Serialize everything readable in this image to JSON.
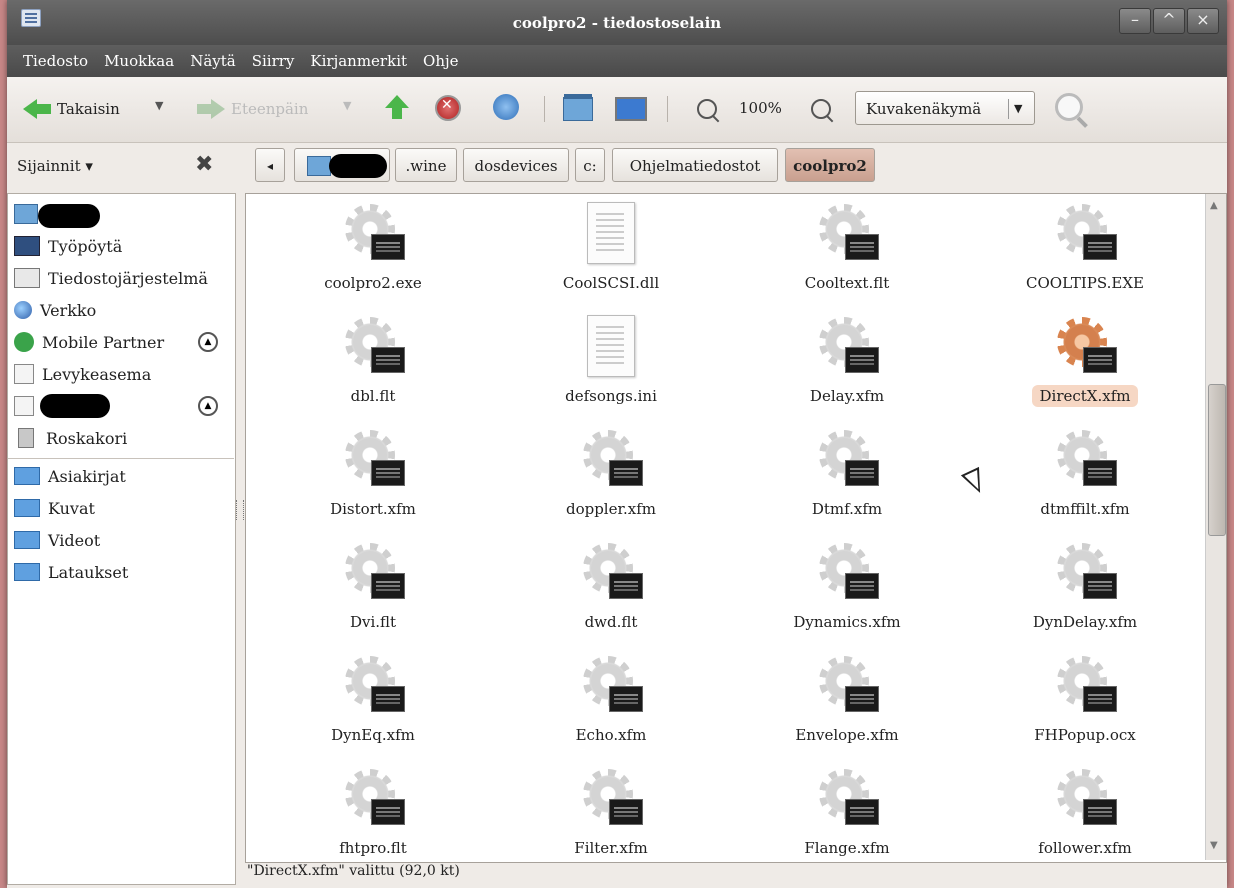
{
  "window": {
    "title": "coolpro2 - tiedostoselain"
  },
  "window_buttons": [
    "–",
    "^",
    "×"
  ],
  "menu": [
    "Tiedosto",
    "Muokkaa",
    "Näytä",
    "Siirry",
    "Kirjanmerkit",
    "Ohje"
  ],
  "toolbar": {
    "back": "Takaisin",
    "forward": "Eteenpäin",
    "zoom": "100%",
    "view_mode": "Kuvakenäkymä"
  },
  "sidebar": {
    "header": "Sijainnit ▾",
    "places": [
      "Työpöytä",
      "Tiedostojärjestelmä",
      "Verkko",
      "Mobile Partner",
      "Levykeasema",
      "Roskakori"
    ],
    "bookmarks": [
      "Asiakirjat",
      "Kuvat",
      "Videot",
      "Lataukset"
    ]
  },
  "breadcrumb": [
    "◂",
    ".wine",
    "dosdevices",
    "c:",
    "Ohjelmatiedostot",
    "coolpro2"
  ],
  "files": [
    {
      "name": "coolpro2.exe",
      "icon": "exe-gear-icon"
    },
    {
      "name": "CoolSCSI.dll",
      "icon": "document-icon"
    },
    {
      "name": "Cooltext.flt",
      "icon": "exe-gear-icon"
    },
    {
      "name": "COOLTIPS.EXE",
      "icon": "exe-gear-icon"
    },
    {
      "name": "dbl.flt",
      "icon": "exe-gear-icon"
    },
    {
      "name": "defsongs.ini",
      "icon": "document-icon"
    },
    {
      "name": "Delay.xfm",
      "icon": "exe-gear-icon"
    },
    {
      "name": "DirectX.xfm",
      "icon": "exe-gear-icon",
      "selected": true
    },
    {
      "name": "Distort.xfm",
      "icon": "exe-gear-icon"
    },
    {
      "name": "doppler.xfm",
      "icon": "exe-gear-icon"
    },
    {
      "name": "Dtmf.xfm",
      "icon": "exe-gear-icon"
    },
    {
      "name": "dtmffilt.xfm",
      "icon": "exe-gear-icon"
    },
    {
      "name": "Dvi.flt",
      "icon": "exe-gear-icon"
    },
    {
      "name": "dwd.flt",
      "icon": "exe-gear-icon"
    },
    {
      "name": "Dynamics.xfm",
      "icon": "exe-gear-icon"
    },
    {
      "name": "DynDelay.xfm",
      "icon": "exe-gear-icon"
    },
    {
      "name": "DynEq.xfm",
      "icon": "exe-gear-icon"
    },
    {
      "name": "Echo.xfm",
      "icon": "exe-gear-icon"
    },
    {
      "name": "Envelope.xfm",
      "icon": "exe-gear-icon"
    },
    {
      "name": "FHPopup.ocx",
      "icon": "exe-gear-icon"
    },
    {
      "name": "fhtpro.flt",
      "icon": "exe-gear-icon"
    },
    {
      "name": "Filter.xfm",
      "icon": "exe-gear-icon"
    },
    {
      "name": "Flange.xfm",
      "icon": "exe-gear-icon"
    },
    {
      "name": "follower.xfm",
      "icon": "exe-gear-icon"
    }
  ],
  "status": "\"DirectX.xfm\" valittu (92,0 kt)",
  "colors": {
    "selection": "#f6d7c4",
    "accent_green": "#4bb64a",
    "titlebar": "#5a5a5a"
  }
}
